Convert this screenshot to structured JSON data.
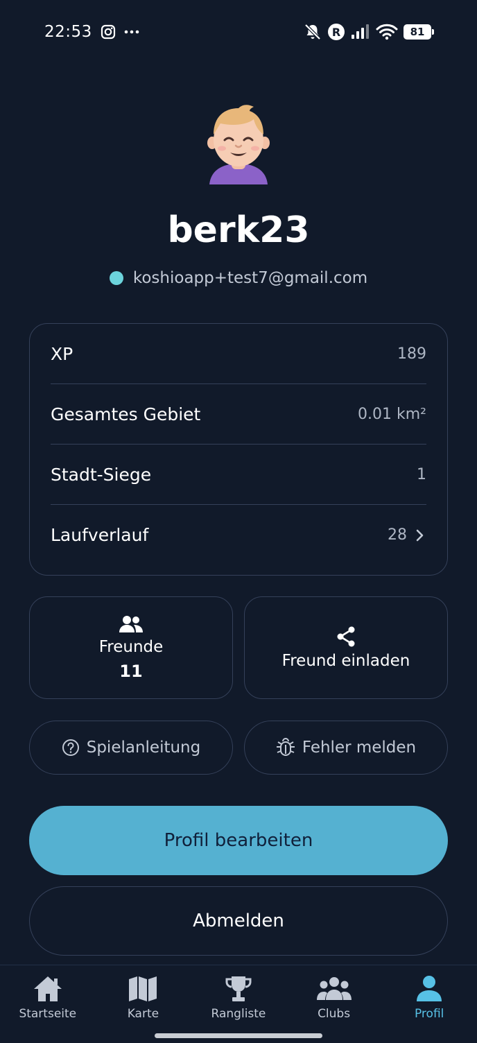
{
  "status_bar": {
    "time": "22:53",
    "icons": [
      "instagram-icon",
      "more-icon",
      "bell-off-icon",
      "r-badge-icon",
      "signal-icon",
      "wifi-icon"
    ],
    "battery": "81"
  },
  "profile": {
    "username": "berk23",
    "email": "koshioapp+test7@gmail.com",
    "status_color": "#6cd3dc"
  },
  "stats": [
    {
      "label": "XP",
      "value": "189"
    },
    {
      "label": "Gesamtes Gebiet",
      "value": "0.01 km²"
    },
    {
      "label": "Stadt-Siege",
      "value": "1"
    },
    {
      "label": "Laufverlauf",
      "value": "28"
    }
  ],
  "tiles": {
    "friends": {
      "label": "Freunde",
      "count": "11"
    },
    "invite": {
      "label": "Freund einladen"
    }
  },
  "pills": {
    "guide": "Spielanleitung",
    "report": "Fehler melden"
  },
  "buttons": {
    "edit": "Profil bearbeiten",
    "logout": "Abmelden"
  },
  "nav": [
    {
      "label": "Startseite",
      "icon": "home-icon"
    },
    {
      "label": "Karte",
      "icon": "map-icon"
    },
    {
      "label": "Rangliste",
      "icon": "trophy-icon"
    },
    {
      "label": "Clubs",
      "icon": "group-icon"
    },
    {
      "label": "Profil",
      "icon": "person-icon"
    }
  ],
  "colors": {
    "background": "#111a2a",
    "accent": "#55b1d1",
    "nav_active": "#57c1e6",
    "border": "#35415a"
  }
}
